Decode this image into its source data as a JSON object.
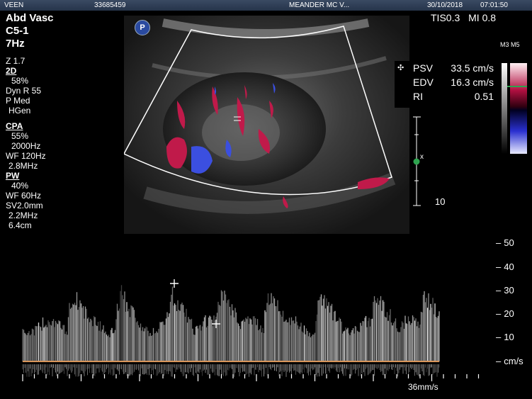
{
  "header": {
    "operator": "VEEN",
    "patient_id": "33685459",
    "institution": "MEANDER MC V...",
    "date": "30/10/2018",
    "time": "07:01:50"
  },
  "left_params": {
    "preset": "Abd Vasc",
    "probe": "C5-1",
    "frequency": "7Hz",
    "zoom": "Z 1.7",
    "mode_2d": "2D",
    "gain_2d": "58%",
    "dyn_range": "Dyn R 55",
    "persistence": "P Med",
    "harmonic": "HGen",
    "cpa": "CPA",
    "cpa_gain": "55%",
    "cpa_prf": "2000Hz",
    "cpa_wf": "WF 120Hz",
    "cpa_freq": "2.8MHz",
    "pw": "PW",
    "pw_gain": "40%",
    "pw_wf": "WF  60Hz",
    "pw_sv": "SV2.0mm",
    "pw_freq": "2.2MHz",
    "pw_depth": "6.4cm"
  },
  "indices": {
    "tis": "TIS0.3",
    "mi": "MI 0.8"
  },
  "map_label": "M3 M5",
  "measurements": [
    {
      "label": "PSV",
      "value": "33.5 cm/s"
    },
    {
      "label": "EDV",
      "value": "16.3 cm/s"
    },
    {
      "label": "RI",
      "value": "0.51"
    }
  ],
  "depth_label": "10",
  "velocity_scale": {
    "labels": [
      "50",
      "40",
      "30",
      "20",
      "10",
      "cm/s"
    ]
  },
  "sweep_speed": "36mm/s",
  "probe_badge": "P",
  "colors": {
    "doppler_red": "#c01a4a",
    "doppler_blue": "#3b4fe0",
    "baseline": "#d8955a",
    "marker_green": "#2ea44f"
  }
}
